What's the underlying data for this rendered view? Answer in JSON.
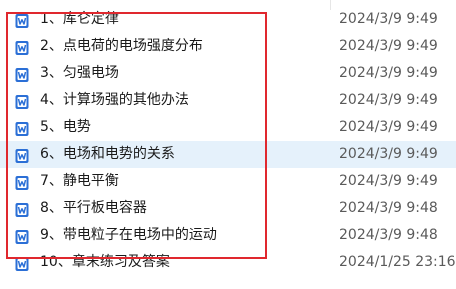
{
  "files": [
    {
      "name": "1、库仑定律",
      "modified": "2024/3/9 9:49",
      "icon": "wps-word-doc-icon"
    },
    {
      "name": "2、点电荷的电场强度分布",
      "modified": "2024/3/9 9:49",
      "icon": "wps-word-doc-icon"
    },
    {
      "name": "3、匀强电场",
      "modified": "2024/3/9 9:49",
      "icon": "wps-word-doc-icon"
    },
    {
      "name": "4、计算场强的其他办法",
      "modified": "2024/3/9 9:49",
      "icon": "wps-word-doc-icon"
    },
    {
      "name": "5、电势",
      "modified": "2024/3/9 9:49",
      "icon": "wps-word-doc-icon"
    },
    {
      "name": "6、电场和电势的关系",
      "modified": "2024/3/9 9:49",
      "icon": "wps-word-doc-icon"
    },
    {
      "name": "7、静电平衡",
      "modified": "2024/3/9 9:49",
      "icon": "wps-word-doc-icon"
    },
    {
      "name": "8、平行板电容器",
      "modified": "2024/3/9 9:48",
      "icon": "wps-word-doc-icon"
    },
    {
      "name": "9、带电粒子在电场中的运动",
      "modified": "2024/3/9 9:48",
      "icon": "wps-word-doc-icon"
    },
    {
      "name": "10、章末练习及答案",
      "modified": "2024/1/25 23:16",
      "icon": "wps-word-doc-icon"
    }
  ],
  "colors": {
    "highlight_border": "#e0282e",
    "selected_row": "#e5f1fb",
    "icon_blue": "#2b6fd6"
  }
}
